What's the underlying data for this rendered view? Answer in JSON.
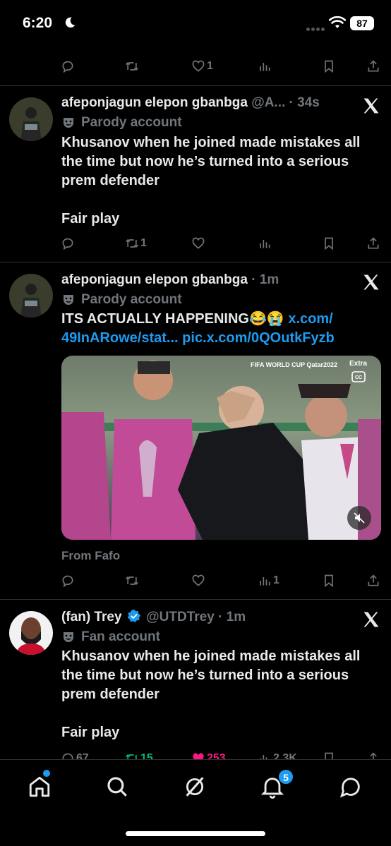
{
  "status_bar": {
    "time": "6:20",
    "battery": "87"
  },
  "feed": {
    "top_post_actions": {
      "likes": "1"
    },
    "posts": [
      {
        "display_name": "afeponjagun elepon gbanbga",
        "meta": "@A... · 34s",
        "badge": "Parody account",
        "text_lines": [
          "Khusanov when he joined made mistakes all",
          "the time but now he’s turned into a serious",
          "prem defender"
        ],
        "text_last": "Fair play",
        "reposts": "1"
      },
      {
        "display_name": "afeponjagun elepon gbanbga",
        "meta": "· 1m",
        "badge": "Parody account",
        "text_start": "ITS ACTUALLY HAPPENING😂😭 ",
        "link1": "x.com/",
        "link2": "49InARowe/stat...",
        "link3": "pic.x.com/0QOutkFyzb",
        "media_overlay_top": "FIFA WORLD CUP Qatar2022",
        "media_overlay_extra": "Extra",
        "from": "From Fafo",
        "views": "1"
      },
      {
        "display_name": "(fan) Trey",
        "handle_meta": "@UTDTrey · 1m",
        "badge": "Fan account",
        "text_lines": [
          "Khusanov when he joined made mistakes all",
          "the time but now he’s turned into a serious",
          "prem defender"
        ],
        "text_last": "Fair play",
        "replies": "67",
        "reposts": "15",
        "likes": "253",
        "views": "2.3K"
      }
    ]
  },
  "bottom_nav": {
    "notifications_count": "5"
  },
  "colors": {
    "accent": "#1d9bf0",
    "muted": "#71767b",
    "like": "#f91880",
    "repost": "#00ba7c"
  }
}
